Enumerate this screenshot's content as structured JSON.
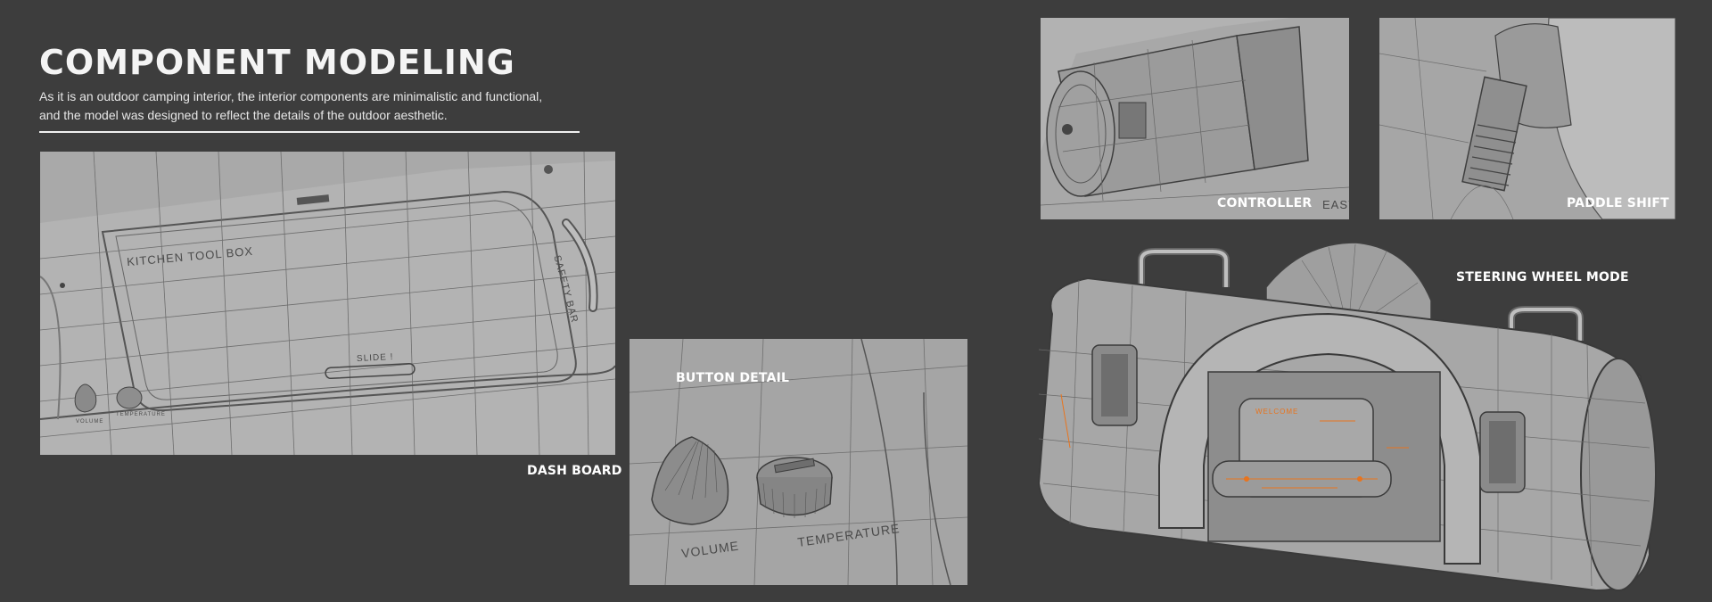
{
  "header": {
    "title": "COMPONENT MODELING",
    "desc_line1": "As it is an outdoor camping interior, the interior components are minimalistic and functional,",
    "desc_line2": "and the model was designed to reflect the details of the outdoor aesthetic."
  },
  "dashboard": {
    "caption": "DASH BOARD",
    "label_toolbox": "KITCHEN TOOL BOX",
    "label_safety": "SAFETY BAR",
    "label_slide": "SLIDE !",
    "label_volume": "VOLUME",
    "label_temperature": "TEMPERATURE"
  },
  "button_detail": {
    "caption": "BUTTON DETAIL",
    "label_volume": "VOLUME",
    "label_temperature": "TEMPERATURE"
  },
  "controller": {
    "caption": "CONTROLLER",
    "label_easy": "EASY"
  },
  "paddle_shift": {
    "caption": "PADDLE SHIFT"
  },
  "steering": {
    "caption": "STEERING WHEEL MODE",
    "label_welcome": "WELCOME"
  },
  "colors": {
    "background": "#3d3d3d",
    "render_gray": "#a8a8a8",
    "accent_orange": "#e8741e"
  }
}
